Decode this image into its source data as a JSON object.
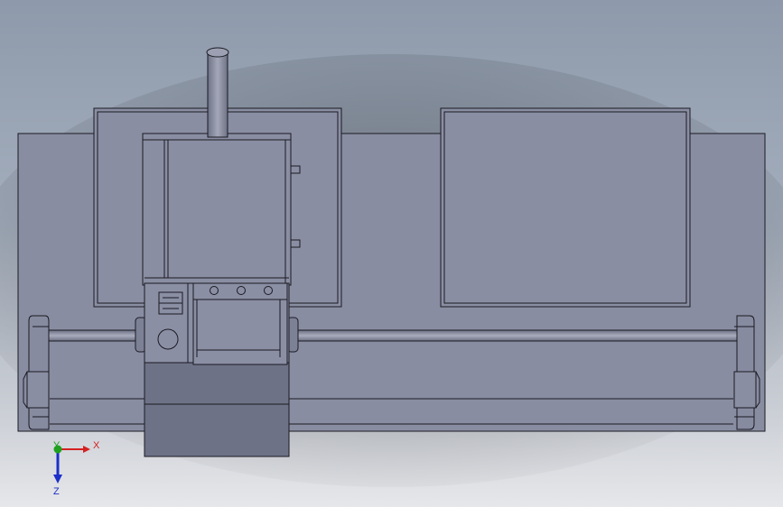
{
  "view": {
    "background_top": "#8c98aa",
    "background_mid": "#a7b1bf",
    "background_bottom": "#e4e5e8",
    "body_color": "#8b8fa4",
    "body_dark": "#6f7388",
    "edge_color": "#1a1a22"
  },
  "triad": {
    "x_label": "X",
    "y_label": "Y",
    "z_label": "Z",
    "x_color": "#d42020",
    "y_color": "#1fa01f",
    "z_color": "#1c2fc8"
  }
}
